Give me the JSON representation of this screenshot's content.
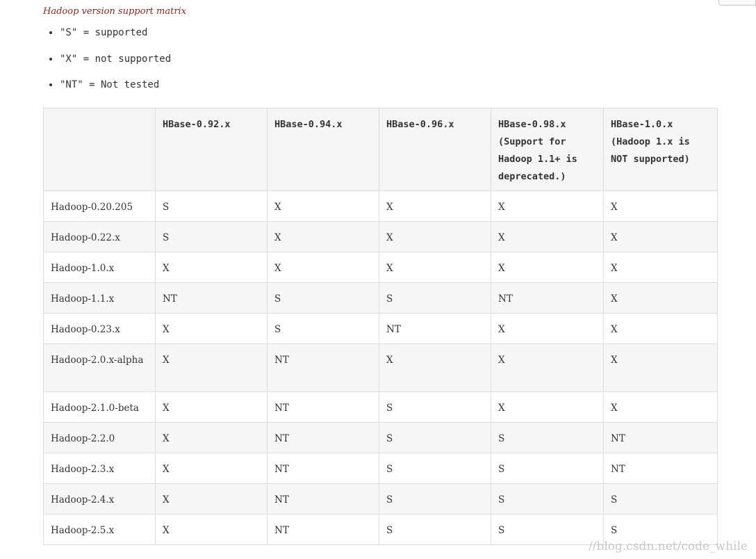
{
  "caption": "Hadoop version support matrix",
  "legend": [
    "\"S\" = supported",
    "\"X\" = not supported",
    "\"NT\" = Not tested"
  ],
  "table": {
    "headers": [
      "",
      "HBase-0.92.x",
      "HBase-0.94.x",
      "HBase-0.96.x",
      "HBase-0.98.x (Support for Hadoop 1.1+ is deprecated.)",
      "HBase-1.0.x (Hadoop 1.x is NOT supported)"
    ],
    "rows": [
      {
        "label": "Hadoop-0.20.205",
        "cells": [
          "S",
          "X",
          "X",
          "X",
          "X"
        ]
      },
      {
        "label": "Hadoop-0.22.x",
        "cells": [
          "S",
          "X",
          "X",
          "X",
          "X"
        ]
      },
      {
        "label": "Hadoop-1.0.x",
        "cells": [
          "X",
          "X",
          "X",
          "X",
          "X"
        ]
      },
      {
        "label": "Hadoop-1.1.x",
        "cells": [
          "NT",
          "S",
          "S",
          "NT",
          "X"
        ]
      },
      {
        "label": "Hadoop-0.23.x",
        "cells": [
          "X",
          "S",
          "NT",
          "X",
          "X"
        ]
      },
      {
        "label": "Hadoop-2.0.x-alpha",
        "cells": [
          "X",
          "NT",
          "X",
          "X",
          "X"
        ]
      },
      {
        "label": "Hadoop-2.1.0-beta",
        "cells": [
          "X",
          "NT",
          "S",
          "X",
          "X"
        ]
      },
      {
        "label": "Hadoop-2.2.0",
        "cells": [
          "X",
          "NT",
          "S",
          "S",
          "NT"
        ]
      },
      {
        "label": "Hadoop-2.3.x",
        "cells": [
          "X",
          "NT",
          "S",
          "S",
          "NT"
        ]
      },
      {
        "label": "Hadoop-2.4.x",
        "cells": [
          "X",
          "NT",
          "S",
          "S",
          "S"
        ]
      },
      {
        "label": "Hadoop-2.5.x",
        "cells": [
          "X",
          "NT",
          "S",
          "S",
          "S"
        ]
      }
    ]
  },
  "watermark": "//blog.csdn.net/code_while"
}
